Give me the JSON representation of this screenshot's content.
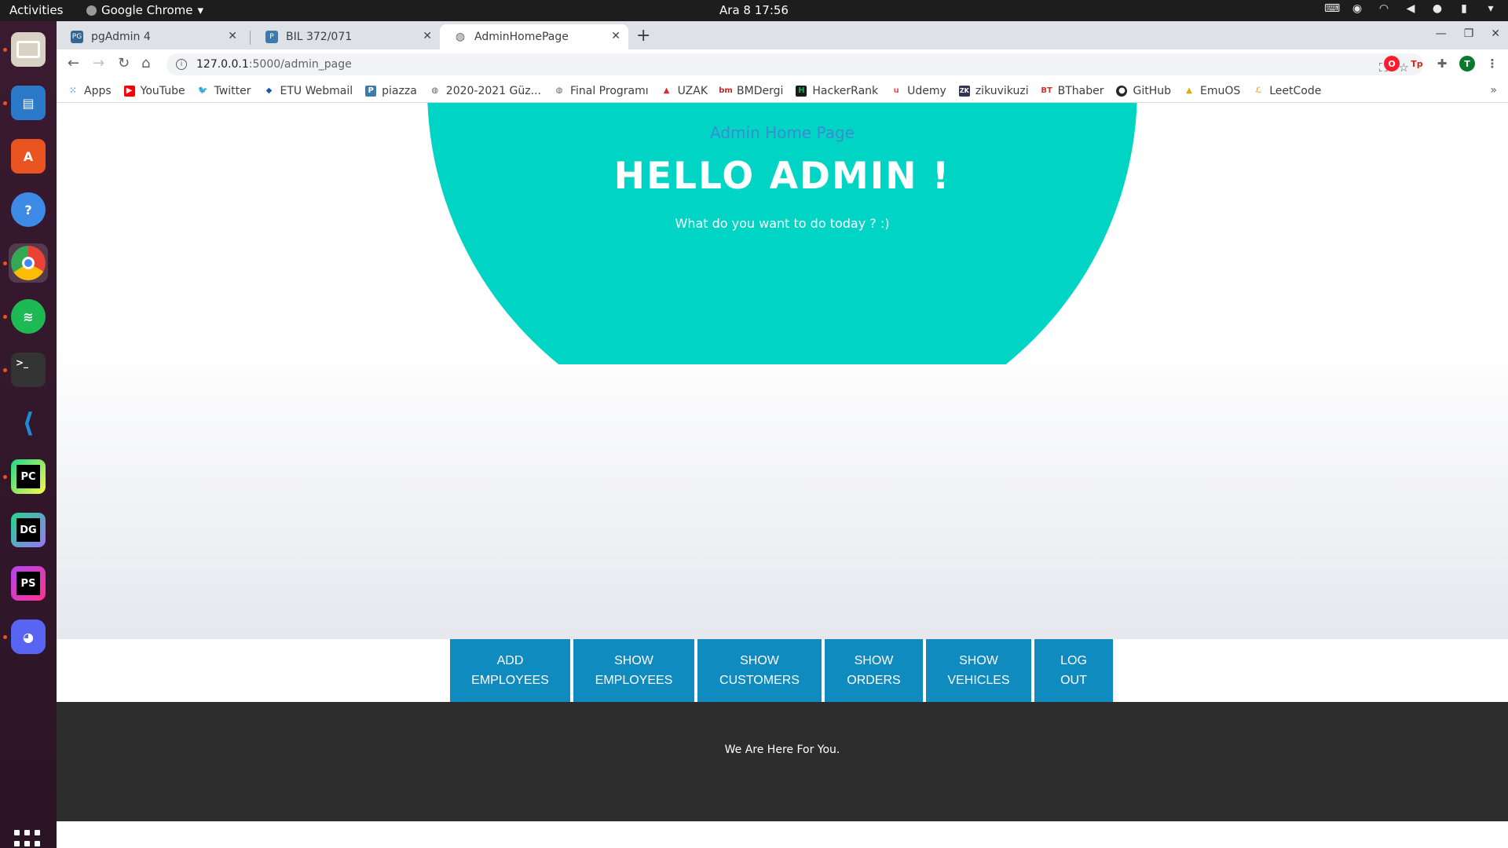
{
  "topbar": {
    "activities": "Activities",
    "app_name": "Google Chrome",
    "clock": "Ara 8  17:56"
  },
  "dock": {
    "items": [
      {
        "name": "files-icon",
        "color": "#c9c3b6"
      },
      {
        "name": "writer-icon",
        "color": "#2a7ac9"
      },
      {
        "name": "software-center-icon",
        "color": "#e95420"
      },
      {
        "name": "help-icon",
        "color": "#3d8be6"
      },
      {
        "name": "chrome-icon",
        "color": "#e8e8e8"
      },
      {
        "name": "spotify-icon",
        "color": "#1db954"
      },
      {
        "name": "terminal-icon",
        "color": "#333333"
      },
      {
        "name": "vscode-icon",
        "color": "#1f8ad6"
      },
      {
        "name": "pycharm-icon",
        "color": "#21d789"
      },
      {
        "name": "datagrip-icon",
        "color": "#22d88f"
      },
      {
        "name": "phpstorm-icon",
        "color": "#b345f1"
      },
      {
        "name": "discord-icon",
        "color": "#5865f2"
      }
    ],
    "labels": {
      "terminal": ">_",
      "pycharm": "PC",
      "datagrip": "DG",
      "phpstorm": "PS",
      "help": "?"
    }
  },
  "browser": {
    "tabs": [
      {
        "title": "pgAdmin 4",
        "favicon": "PG"
      },
      {
        "title": "BIL 372/071",
        "favicon": "P"
      },
      {
        "title": "AdminHomePage",
        "favicon": "globe"
      }
    ],
    "url_host": "127.0.0.1",
    "url_path": ":5000/admin_page",
    "profile_initial": "T",
    "bookmarks": [
      {
        "label": "Apps",
        "icon": "apps-icon",
        "color": "#4285f4"
      },
      {
        "label": "YouTube",
        "icon": "youtube-icon",
        "color": "#ff0000"
      },
      {
        "label": "Twitter",
        "icon": "twitter-icon",
        "color": "#1da1f2"
      },
      {
        "label": "ETU Webmail",
        "icon": "webmail-icon",
        "color": "#1a5aa8"
      },
      {
        "label": "piazza",
        "icon": "piazza-icon",
        "color": "#3e7aab"
      },
      {
        "label": "2020-2021 Güz...",
        "icon": "globe-icon",
        "color": "#5f6368"
      },
      {
        "label": "Final Programı",
        "icon": "globe-icon",
        "color": "#5f6368"
      },
      {
        "label": "UZAK",
        "icon": "uzak-icon",
        "color": "#d32f2f"
      },
      {
        "label": "BMDergi",
        "icon": "bmdergi-icon",
        "color": "#c62828"
      },
      {
        "label": "HackerRank",
        "icon": "hackerrank-icon",
        "color": "#1ba94c"
      },
      {
        "label": "Udemy",
        "icon": "udemy-icon",
        "color": "#ec5252"
      },
      {
        "label": "zikuvikuzi",
        "icon": "zk-icon",
        "color": "#333355"
      },
      {
        "label": "BThaber",
        "icon": "bt-icon",
        "color": "#d32f2f"
      },
      {
        "label": "GitHub",
        "icon": "github-icon",
        "color": "#24292e"
      },
      {
        "label": "EmuOS",
        "icon": "emuos-icon",
        "color": "#e0a800"
      },
      {
        "label": "LeetCode",
        "icon": "leetcode-icon",
        "color": "#f89f1b"
      }
    ],
    "bookmarks_more": "»"
  },
  "page": {
    "subtitle": "Admin Home Page",
    "title": "HELLO ADMIN !",
    "text": "What do you want to do today ? :)",
    "accent": "#00d4c5",
    "button_color": "#0f8bbf",
    "buttons": [
      {
        "line1": "ADD",
        "line2": "EMPLOYEES"
      },
      {
        "line1": "SHOW",
        "line2": "EMPLOYEES"
      },
      {
        "line1": "SHOW",
        "line2": "CUSTOMERS"
      },
      {
        "line1": "SHOW",
        "line2": "ORDERS"
      },
      {
        "line1": "SHOW",
        "line2": "VEHICLES"
      },
      {
        "line1": "LOG",
        "line2": "OUT"
      }
    ],
    "footer": "We Are Here For You."
  }
}
